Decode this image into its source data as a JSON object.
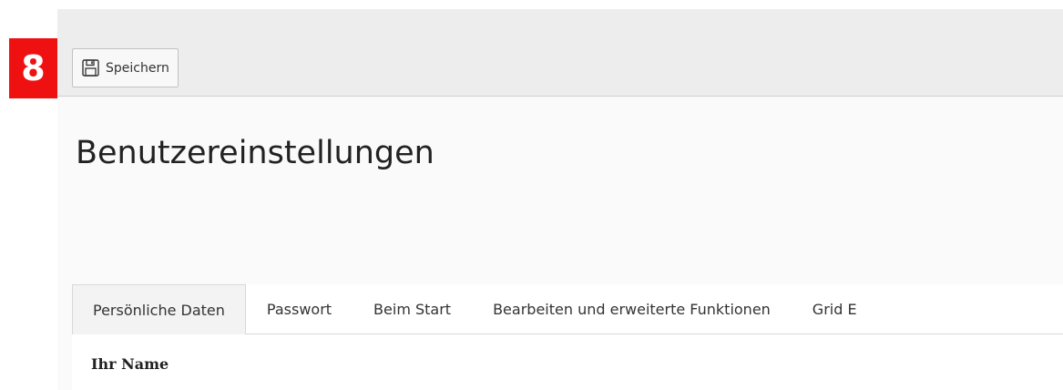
{
  "step_badge": "8",
  "toolbar": {
    "save_label": "Speichern",
    "save_icon": "floppy-disk-icon"
  },
  "page": {
    "title": "Benutzereinstellungen"
  },
  "tabs": [
    {
      "label": "Persönliche Daten",
      "active": true
    },
    {
      "label": "Passwort",
      "active": false
    },
    {
      "label": "Beim Start",
      "active": false
    },
    {
      "label": "Bearbeiten und erweiterte Funktionen",
      "active": false
    },
    {
      "label": "Grid E",
      "active": false
    }
  ],
  "form": {
    "name_label": "Ihr Name"
  },
  "colors": {
    "badge": "#ef1111",
    "toolbar": "#ededed",
    "active_tab": "#f3f3f3"
  }
}
